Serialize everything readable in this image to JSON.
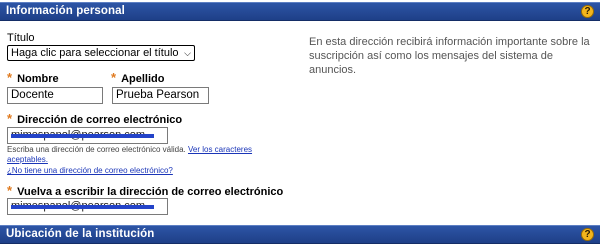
{
  "section1": {
    "title": "Información personal",
    "help": "?"
  },
  "titulo": {
    "label": "Título",
    "selected": "Haga clic para seleccionar el título"
  },
  "info_text": "En esta dirección recibirá información importante sobre la suscripción así como los mensajes del sistema de anuncios.",
  "nombre": {
    "label": "Nombre",
    "value": "Docente"
  },
  "apellido": {
    "label": "Apellido",
    "value": "Prueba Pearson"
  },
  "email": {
    "label": "Dirección de correo electrónico",
    "value": "mimespanol@pearson.com",
    "help_prefix": "Escriba una dirección de correo electrónico válida.",
    "help_link": "Ver los caracteres",
    "help_link2": "aceptables.",
    "no_email_link": "¿No tiene una dirección de correo electrónico?"
  },
  "email_confirm": {
    "label": "Vuelva a escribir la dirección de correo electrónico",
    "value": "mimespanol@pearson.com"
  },
  "section2": {
    "title": "Ubicación de la institución",
    "help": "?"
  },
  "required_marker": "*",
  "colors": {
    "bar": "#2d55a6",
    "required": "#e07a1f",
    "help_button": "#f3b51c",
    "link": "#1a35b8",
    "redaction": "#2343c8"
  }
}
